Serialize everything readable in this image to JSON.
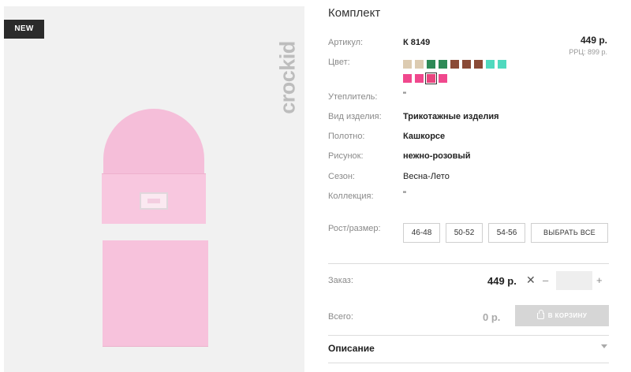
{
  "product": {
    "badge": "NEW",
    "brand": "crockid",
    "title": "Комплект",
    "price": "449 р.",
    "rrp": "РРЦ: 899 р."
  },
  "attributes": {
    "article_label": "Артикул:",
    "article_value": "К 8149",
    "color_label": "Цвет:",
    "insulation_label": "Утеплитель:",
    "insulation_value": "\"",
    "type_label": "Вид изделия:",
    "type_value": "Трикотажные изделия",
    "fabric_label": "Полотно:",
    "fabric_value": "Кашкорсе",
    "pattern_label": "Рисунок:",
    "pattern_value": "нежно-розовый",
    "season_label": "Сезон:",
    "season_value": "Весна-Лето",
    "collection_label": "Коллекция:",
    "collection_value": "\"",
    "size_label": "Рост/размер:"
  },
  "colors": [
    {
      "hex": "#dccbb1",
      "selected": false
    },
    {
      "hex": "#dccbb1",
      "selected": false
    },
    {
      "hex": "#2e8a57",
      "selected": false
    },
    {
      "hex": "#2e8a57",
      "selected": false
    },
    {
      "hex": "#8a4a36",
      "selected": false
    },
    {
      "hex": "#8a4a36",
      "selected": false
    },
    {
      "hex": "#8a4a36",
      "selected": false
    },
    {
      "hex": "#4fd9be",
      "selected": false
    },
    {
      "hex": "#4fd9be",
      "selected": false
    },
    {
      "hex": "#f0488d",
      "selected": false
    },
    {
      "hex": "#f0488d",
      "selected": false
    },
    {
      "hex": "#e8457f",
      "selected": true
    },
    {
      "hex": "#f0488d",
      "selected": false
    }
  ],
  "sizes": [
    "46-48",
    "50-52",
    "54-56"
  ],
  "select_all": "ВЫБРАТЬ ВСЕ",
  "order": {
    "label": "Заказ:",
    "price": "449 р.",
    "times": "✕",
    "minus": "–",
    "qty": "",
    "plus": "+"
  },
  "total": {
    "label": "Всего:",
    "value": "0 р.",
    "cart_button": "В КОРЗИНУ"
  },
  "description": {
    "title": "Описание"
  }
}
